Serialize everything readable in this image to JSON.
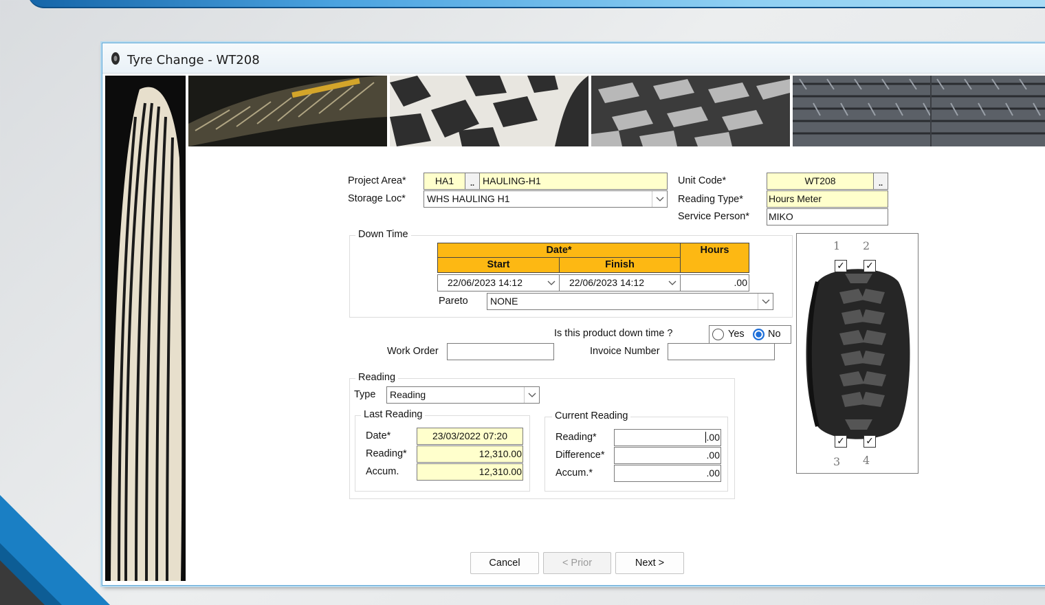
{
  "window": {
    "title": "Tyre Change - WT208"
  },
  "header": {
    "project_area_label": "Project Area*",
    "project_area_code": "HA1",
    "project_area_name": "HAULING-H1",
    "storage_loc_label": "Storage Loc*",
    "storage_loc_value": "WHS HAULING H1",
    "unit_code_label": "Unit Code*",
    "unit_code_value": "WT208",
    "reading_type_label": "Reading Type*",
    "reading_type_value": "Hours Meter",
    "service_person_label": "Service Person*",
    "service_person_value": "MIKO",
    "lookup_button": ".."
  },
  "downtime": {
    "title": "Down Time",
    "date_header": "Date*",
    "start_header": "Start",
    "finish_header": "Finish",
    "hours_header": "Hours",
    "start_value": "22/06/2023 14:12",
    "finish_value": "22/06/2023 14:12",
    "hours_value": ".00",
    "pareto_label": "Pareto",
    "pareto_value": "NONE"
  },
  "product_downtime": {
    "question": "Is this product down time ?",
    "yes_label": "Yes",
    "no_label": "No",
    "selected": "No"
  },
  "work_order": {
    "label": "Work Order",
    "value": ""
  },
  "invoice": {
    "label": "Invoice Number",
    "value": ""
  },
  "reading": {
    "title": "Reading",
    "type_label": "Type",
    "type_value": "Reading",
    "last": {
      "title": "Last Reading",
      "date_label": "Date*",
      "date_value": "23/03/2022 07:20",
      "reading_label": "Reading*",
      "reading_value": "12,310.00",
      "accum_label": "Accum.",
      "accum_value": "12,310.00"
    },
    "current": {
      "title": "Current Reading",
      "reading_label": "Reading*",
      "reading_value": ".00",
      "difference_label": "Difference*",
      "difference_value": ".00",
      "accum_label": "Accum.*",
      "accum_value": ".00"
    }
  },
  "tyre_positions": {
    "labels": [
      "1",
      "2",
      "3",
      "4"
    ],
    "checked": [
      true,
      true,
      true,
      true
    ]
  },
  "buttons": {
    "cancel": "Cancel",
    "prior": "< Prior",
    "next": "Next >"
  }
}
